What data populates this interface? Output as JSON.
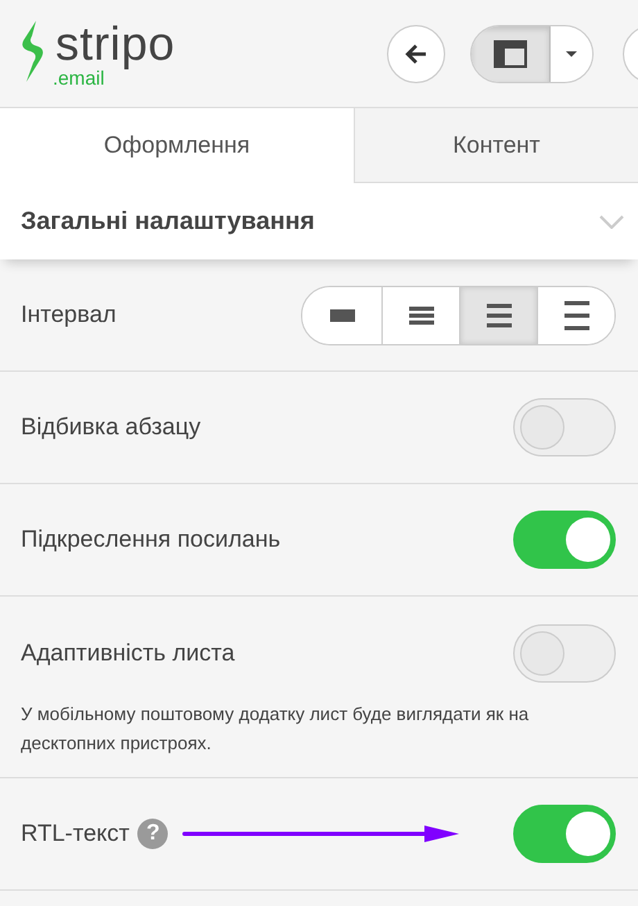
{
  "logo": {
    "name": "stripo",
    "suffix": ".email"
  },
  "tabs": [
    {
      "label": "Оформлення",
      "selected": true
    },
    {
      "label": "Контент",
      "selected": false
    }
  ],
  "layout_view": {
    "selected": true
  },
  "section": {
    "title": "Загальні налаштування",
    "expanded": true
  },
  "interval": {
    "label": "Інтервал",
    "options": [
      {
        "selected": false
      },
      {
        "selected": false
      },
      {
        "selected": true
      },
      {
        "selected": false
      }
    ]
  },
  "settings": [
    {
      "label": "Відбивка абзацу",
      "on": false
    },
    {
      "label": "Підкреслення посилань",
      "on": true
    },
    {
      "label": "Адаптивність листа",
      "on": false,
      "note": "У мобільному поштовому додатку лист буде виглядати як на десктопних пристроях."
    },
    {
      "label": "RTL-текст",
      "on": true,
      "help": "?",
      "arrow": true
    }
  ]
}
